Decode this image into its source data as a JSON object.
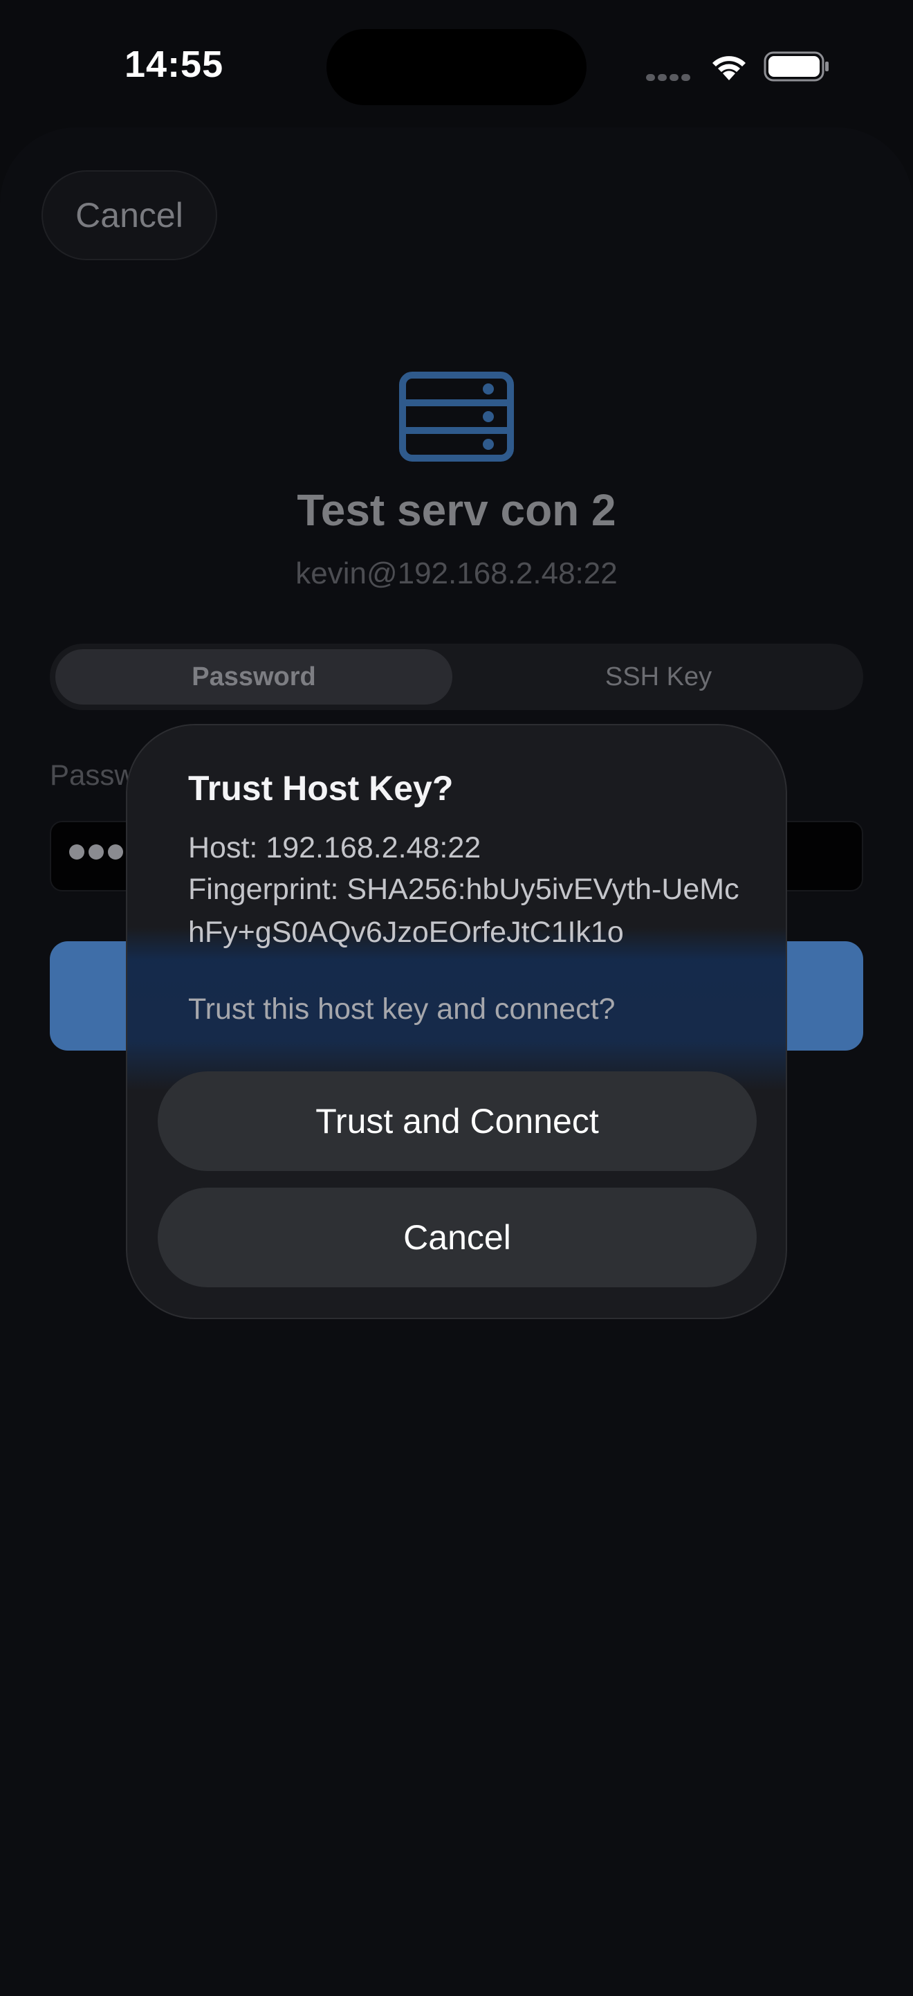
{
  "status_bar": {
    "time": "14:55"
  },
  "header": {
    "cancel_label": "Cancel"
  },
  "server": {
    "name": "Test serv con 2",
    "address": "kevin@192.168.2.48:22"
  },
  "auth_tabs": [
    {
      "label": "Password",
      "selected": true
    },
    {
      "label": "SSH Key",
      "selected": false
    }
  ],
  "password": {
    "label": "Password"
  },
  "dialog": {
    "title": "Trust Host Key?",
    "host_line": "Host: 192.168.2.48:22",
    "fingerprint_line": "Fingerprint: SHA256:hbUy5ivEVyth-UeMchFy+gS0AQv6JzoEOrfeJtC1Ik1o",
    "question": "Trust this host key and connect?",
    "trust_label": "Trust and Connect",
    "cancel_label": "Cancel"
  },
  "colors": {
    "accent": "#3f6ea8",
    "background": "#0a0b0e",
    "dialog": "#1a1b1f"
  }
}
